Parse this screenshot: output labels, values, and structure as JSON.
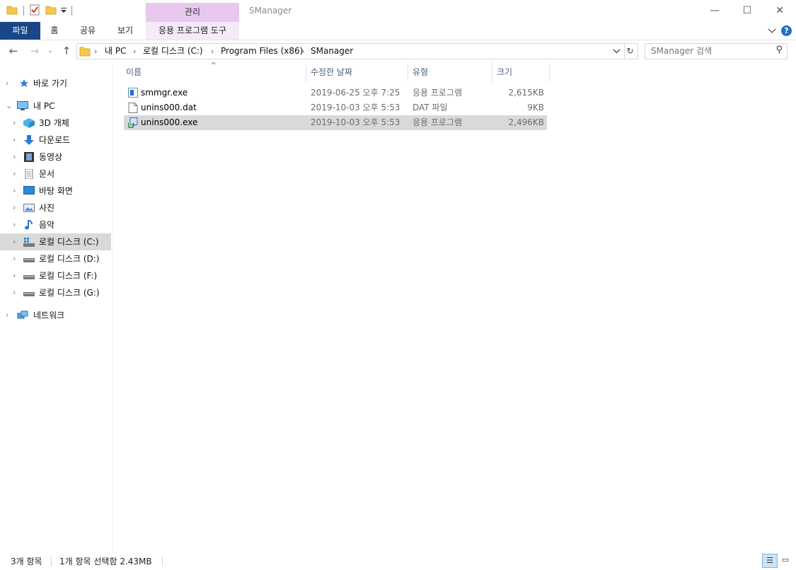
{
  "window": {
    "title": "SManager",
    "context_tab_group": "관리",
    "controls": {
      "minimize": "—",
      "maximize": "☐",
      "close": "✕"
    }
  },
  "ribbon": {
    "tabs": [
      {
        "label": "파일"
      },
      {
        "label": "홈"
      },
      {
        "label": "공유"
      },
      {
        "label": "보기"
      },
      {
        "label": "응용 프로그램 도구"
      }
    ],
    "collapse_icon": "chevron-down-icon",
    "help_label": "?"
  },
  "address_bar": {
    "breadcrumbs": [
      "내 PC",
      "로컬 디스크 (C:)",
      "Program Files (x86)",
      "SManager"
    ],
    "search_placeholder": "SManager 검색"
  },
  "nav_pane": {
    "quick_access": "바로 가기",
    "this_pc": "내 PC",
    "items": [
      {
        "label": "3D 개체",
        "icon": "3d-objects-icon"
      },
      {
        "label": "다운로드",
        "icon": "download-arrow-icon"
      },
      {
        "label": "동영상",
        "icon": "film-icon"
      },
      {
        "label": "문서",
        "icon": "document-icon"
      },
      {
        "label": "바탕 화면",
        "icon": "desktop-icon"
      },
      {
        "label": "사진",
        "icon": "picture-icon"
      },
      {
        "label": "음악",
        "icon": "music-note-icon"
      },
      {
        "label": "로컬 디스크 (C:)",
        "icon": "windows-drive-icon"
      },
      {
        "label": "로컬 디스크 (D:)",
        "icon": "drive-icon"
      },
      {
        "label": "로컬 디스크 (F:)",
        "icon": "drive-icon"
      },
      {
        "label": "로컬 디스크 (G:)",
        "icon": "drive-icon"
      }
    ],
    "network": "네트워크"
  },
  "file_list": {
    "columns": [
      "이름",
      "수정한 날짜",
      "유형",
      "크기"
    ],
    "sort_indicator": "^",
    "rows": [
      {
        "name": "smmgr.exe",
        "modified": "2019-06-25 오후 7:25",
        "type": "응용 프로그램",
        "size": "2,615KB"
      },
      {
        "name": "unins000.dat",
        "modified": "2019-10-03 오후 5:53",
        "type": "DAT 파일",
        "size": "9KB"
      },
      {
        "name": "unins000.exe",
        "modified": "2019-10-03 오후 5:53",
        "type": "응용 프로그램",
        "size": "2,496KB"
      }
    ]
  },
  "status_bar": {
    "item_count": "3개 항목",
    "selection": "1개 항목 선택함 2.43MB"
  },
  "colors": {
    "file_tab_bg": "#19478a",
    "manage_tab_bg": "#e8c8ef",
    "selection_bg": "#d9d9d9",
    "column_header_text": "#4c607a"
  }
}
